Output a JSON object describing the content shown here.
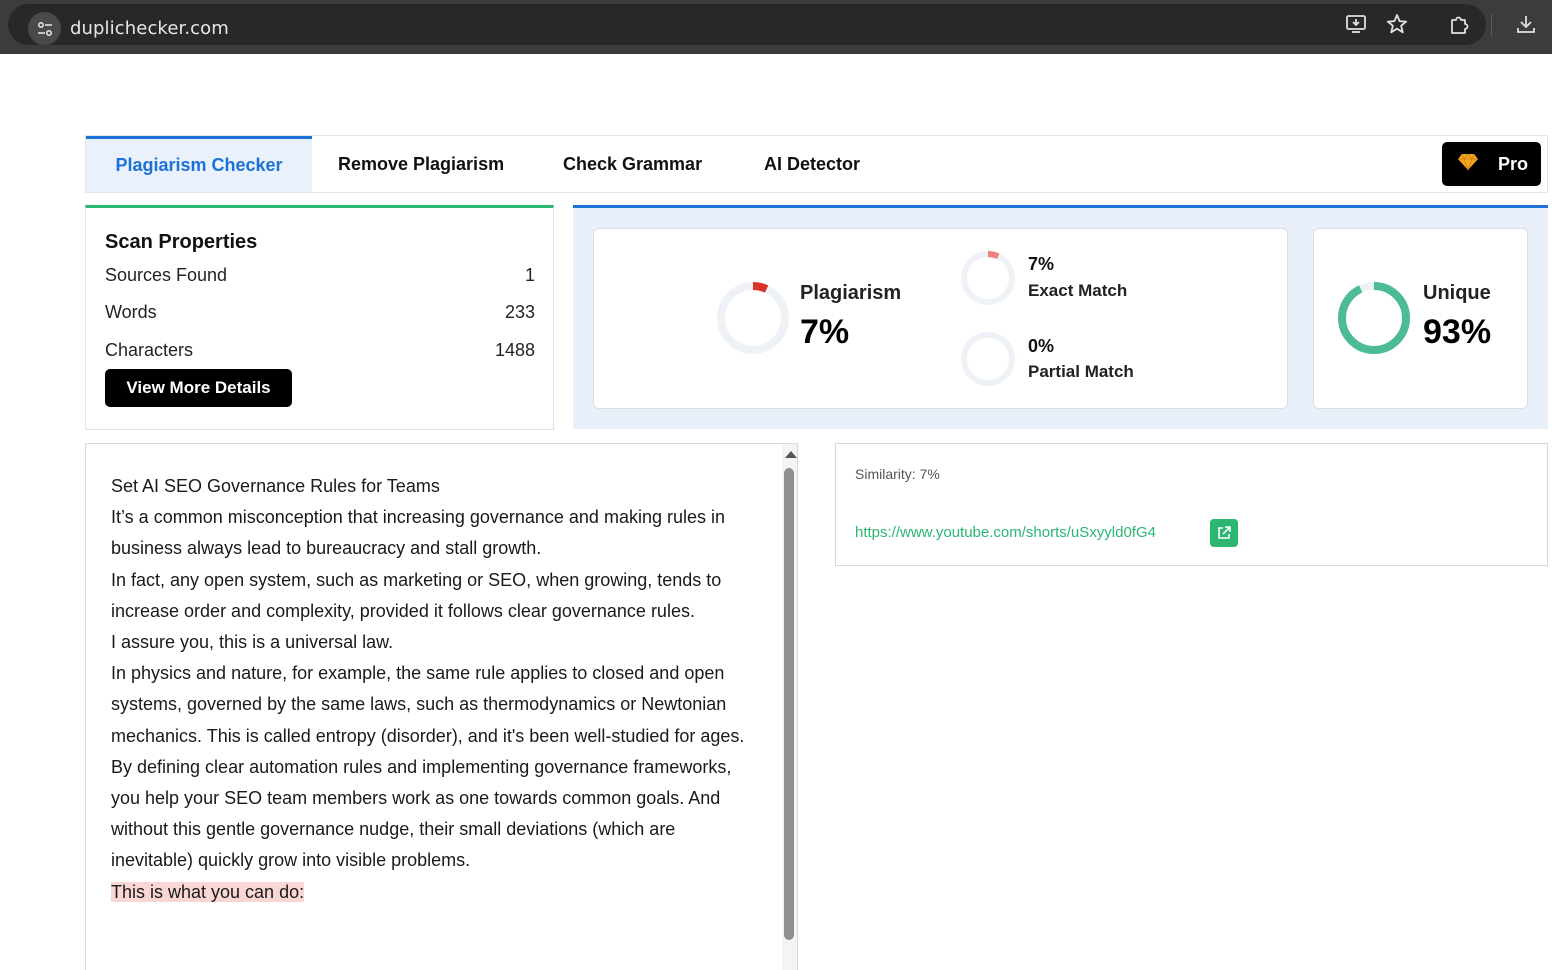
{
  "browser": {
    "url": "duplichecker.com",
    "icons": [
      "site-info-icon",
      "install-app-icon",
      "bookmark-star-icon",
      "extensions-icon",
      "download-icon"
    ]
  },
  "tabs": [
    {
      "label": "Plagiarism Checker",
      "active": true
    },
    {
      "label": "Remove Plagiarism",
      "active": false
    },
    {
      "label": "Check Grammar",
      "active": false
    },
    {
      "label": "AI Detector",
      "active": false
    }
  ],
  "pro_label": "Pro",
  "scan": {
    "title": "Scan Properties",
    "rows": [
      {
        "label": "Sources Found",
        "value": "1"
      },
      {
        "label": "Words",
        "value": "233"
      },
      {
        "label": "Characters",
        "value": "1488"
      }
    ],
    "details_button": "View More Details"
  },
  "results": {
    "plagiarism": {
      "label": "Plagiarism",
      "value": "7%",
      "fraction": 0.07
    },
    "exact": {
      "label": "Exact Match",
      "value": "7%",
      "fraction": 0.07
    },
    "partial": {
      "label": "Partial Match",
      "value": "0%",
      "fraction": 0.0
    },
    "unique": {
      "label": "Unique",
      "value": "93%",
      "fraction": 0.93
    }
  },
  "colors": {
    "accent": "#1d72d8",
    "green": "#2bb673",
    "plag_red": "#d9342b",
    "exact_red": "#f08080",
    "unique_green": "#4dbb94",
    "ring_bg": "#eef2f7",
    "highlight": "#fbd6d6"
  },
  "text": {
    "paragraphs": [
      {
        "text": "Set AI SEO Governance Rules for Teams",
        "highlight": false
      },
      {
        "text": "It’s a common misconception that increasing governance and making rules in business always lead to bureaucracy and stall growth.",
        "highlight": false
      },
      {
        "text": "In fact, any open system, such as marketing or SEO, when growing, tends to increase order and complexity, provided it follows clear governance rules.",
        "highlight": false
      },
      {
        "text": "I assure you, this is a universal law.",
        "highlight": false
      },
      {
        "text": "In physics and nature, for example, the same rule applies to closed and open systems, governed by the same laws, such as thermodynamics or Newtonian mechanics. This is called entropy (disorder), and it's been well-studied for ages.",
        "highlight": false
      },
      {
        "text": "By defining clear automation rules and implementing governance frameworks, you help your SEO team members work as one towards common goals. And without this gentle governance nudge, their small deviations (which are inevitable) quickly grow into visible problems.",
        "highlight": false
      },
      {
        "text": "This is what you can do:",
        "highlight": true
      }
    ]
  },
  "similarity": {
    "label": "Similarity: 7%",
    "url": "https://www.youtube.com/shorts/uSxyyld0fG4"
  }
}
